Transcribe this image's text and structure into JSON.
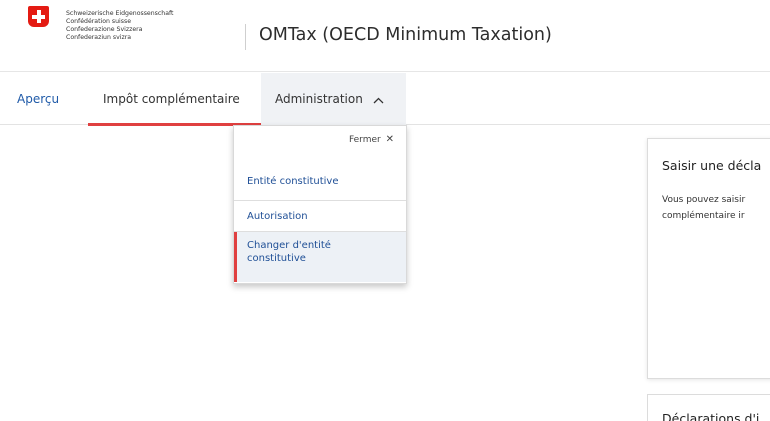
{
  "header": {
    "federation_lines": [
      "Schweizerische Eidgenossenschaft",
      "Confédération suisse",
      "Confederazione Svizzera",
      "Confederaziun svizra"
    ],
    "app_title": "OMTax (OECD Minimum Taxation)"
  },
  "nav": {
    "items": [
      {
        "label": "Aperçu"
      },
      {
        "label": "Impôt complémentaire"
      },
      {
        "label": "Administration"
      }
    ]
  },
  "dropdown": {
    "close_label": "Fermer",
    "items": [
      {
        "label": "Entité constitutive"
      },
      {
        "label": "Autorisation"
      },
      {
        "label": "Changer d'entité constitutive"
      }
    ]
  },
  "card": {
    "title": "Saisir une décla",
    "text_lines": [
      "Vous pouvez saisir",
      "complémentaire ir"
    ]
  },
  "card2": {
    "title": "Déclarations d'i"
  },
  "colors": {
    "accent_red": "#e04040",
    "link_blue": "#1f5aa8",
    "swiss_red": "#e41b13"
  }
}
